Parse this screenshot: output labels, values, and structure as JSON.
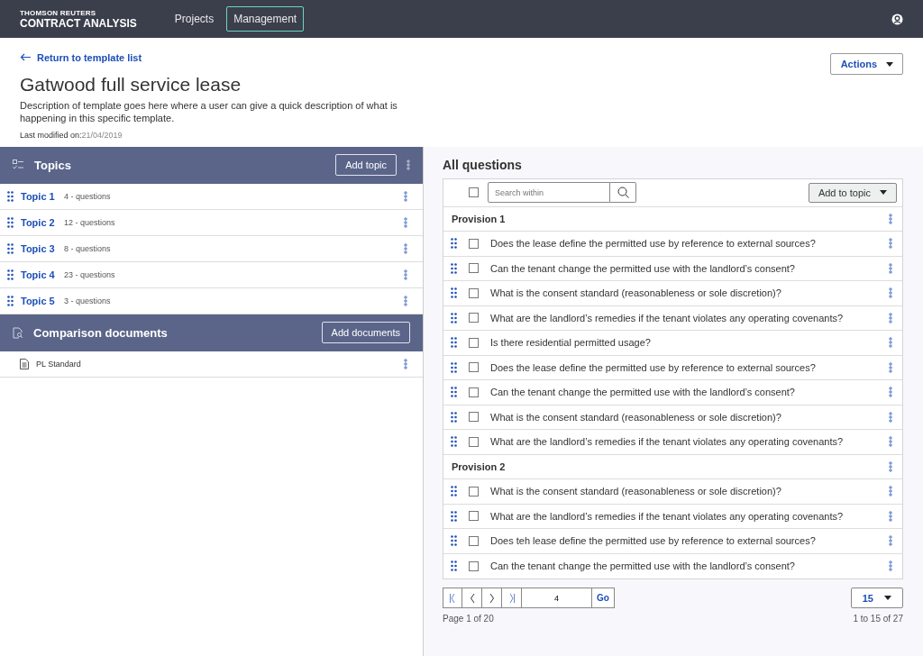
{
  "nav": {
    "brand_top": "THOMSON REUTERS",
    "brand": "CONTRACT ANALYSIS",
    "tabs": [
      {
        "label": "Projects",
        "selected": false
      },
      {
        "label": "Management",
        "selected": true
      }
    ]
  },
  "page": {
    "back_link": "Return to template list",
    "title": "Gatwood full service lease",
    "description": "Description of template goes here where a user can give a quick description of what is happening in this specific template.",
    "modified_label": "Last modified on:",
    "modified_date": "21/04/2019",
    "actions": "Actions"
  },
  "topics": {
    "title": "Topics",
    "add_button": "Add topic",
    "items": [
      {
        "name": "Topic 1",
        "count": "4 - questions"
      },
      {
        "name": "Topic 2",
        "count": "12 - questions"
      },
      {
        "name": "Topic 3",
        "count": "8 - questions"
      },
      {
        "name": "Topic 4",
        "count": "23 - questions"
      },
      {
        "name": "Topic 5",
        "count": "3 - questions"
      }
    ]
  },
  "comparison": {
    "title": "Comparison documents",
    "add_button": "Add documents",
    "documents": [
      {
        "name": "PL Standard"
      }
    ]
  },
  "questions": {
    "title": "All questions",
    "select_all_checked": false,
    "search_placeholder": "Search within",
    "add_to_topic": "Add to topic",
    "groups": [
      {
        "title": "Provision 1",
        "items": [
          {
            "text": "Does the lease define the permitted use by reference to external sources?",
            "checked": false
          },
          {
            "text": "Can the tenant change the permitted use with the landlord’s consent?",
            "checked": false
          },
          {
            "text": "What is the consent standard (reasonableness or sole discretion)?",
            "checked": false
          },
          {
            "text": "What are the landlord’s remedies if the tenant violates any operating covenants?",
            "checked": false
          },
          {
            "text": "Is there residential permitted usage?",
            "checked": false
          },
          {
            "text": "Does the lease define the permitted use by reference to external sources?",
            "checked": false
          },
          {
            "text": "Can the tenant change the permitted use with the landlord’s consent?",
            "checked": false
          },
          {
            "text": "What is the consent standard (reasonableness or sole discretion)?",
            "checked": false
          },
          {
            "text": "What are the landlord’s remedies if the tenant violates any operating covenants?",
            "checked": false
          }
        ]
      },
      {
        "title": "Provision 2",
        "items": [
          {
            "text": "What is the consent standard (reasonableness or sole discretion)?",
            "checked": false
          },
          {
            "text": "What are the landlord’s remedies if the tenant violates any operating covenants?",
            "checked": false
          },
          {
            "text": "Does teh lease define the permitted use by reference to external sources?",
            "checked": false
          },
          {
            "text": "Can the tenant change the permitted use with the landlord’s consent?",
            "checked": false
          }
        ]
      }
    ]
  },
  "pagination": {
    "page_input": "4",
    "go": "Go",
    "per_page": "15",
    "page_info": "Page 1 of 20",
    "range": "1 to 15 of 27"
  }
}
